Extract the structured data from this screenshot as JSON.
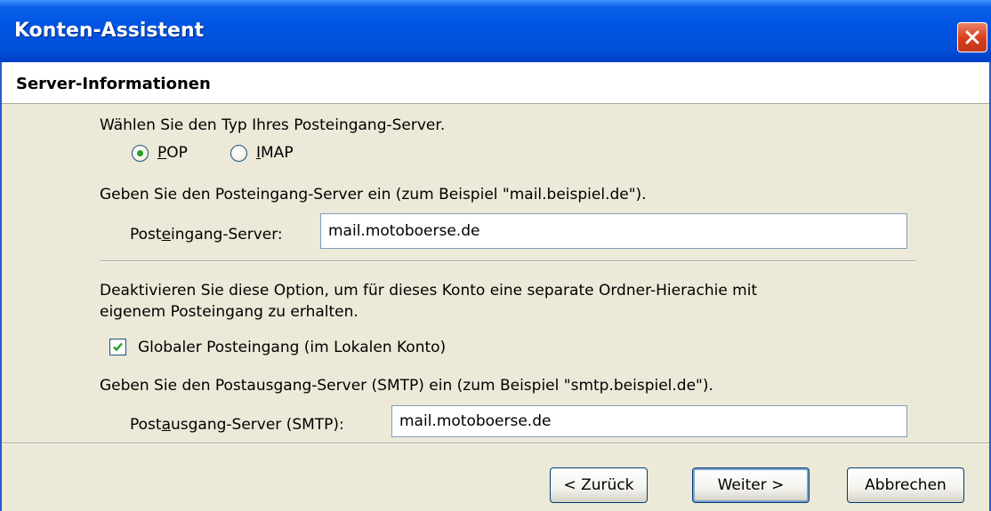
{
  "window": {
    "title": "Konten-Assistent"
  },
  "page": {
    "title": "Server-Informationen"
  },
  "incoming_type": {
    "prompt": "Wählen Sie den Typ Ihres Posteingang-Server.",
    "options": [
      {
        "label_accel": "P",
        "label_rest": "OP",
        "checked": true
      },
      {
        "label_accel": "I",
        "label_rest": "MAP",
        "checked": false
      }
    ]
  },
  "incoming_server": {
    "hint": "Geben Sie den Posteingang-Server ein (zum Beispiel \"mail.beispiel.de\").",
    "label_pre": "Post",
    "label_accel": "e",
    "label_post": "ingang-Server:",
    "value": "mail.motoboerse.de"
  },
  "global_inbox": {
    "description_line1": "Deaktivieren Sie diese Option, um für dieses Konto eine separate Ordner-Hierachie mit",
    "description_line2": "eigenem Posteingang zu erhalten.",
    "checkbox_label": "Globaler Posteingang (im Lokalen Konto)",
    "checked": true
  },
  "outgoing_server": {
    "hint": "Geben Sie den Postausgang-Server (SMTP) ein (zum Beispiel \"smtp.beispiel.de\").",
    "label_pre": "Post",
    "label_accel": "a",
    "label_post": "usgang-Server (SMTP):",
    "value": "mail.motoboerse.de"
  },
  "buttons": {
    "back": "< Zurück",
    "next": "Weiter >",
    "cancel": "Abbrechen"
  },
  "colors": {
    "titlebar": "#0054E3",
    "dialog_face": "#ECE9D8",
    "close_button": "#D8431E",
    "radio_dot": "#21A121",
    "checkmark": "#21A121"
  }
}
